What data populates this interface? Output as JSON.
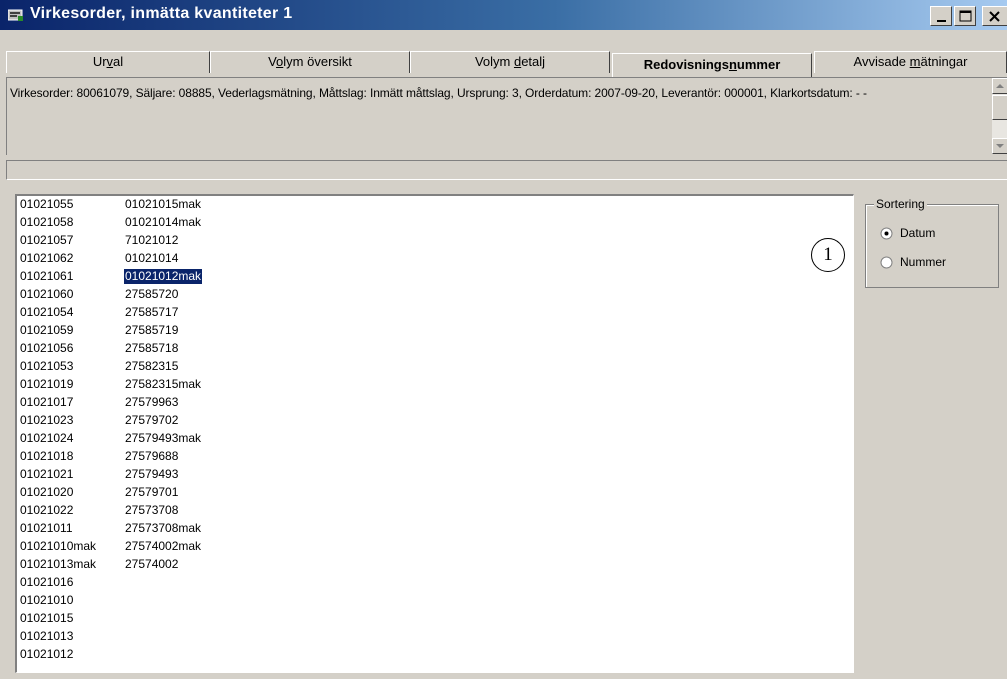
{
  "window": {
    "title": "Virkesorder, inmätta kvantiteter 1"
  },
  "tabs": [
    {
      "pre": "Ur",
      "key": "v",
      "post": "al"
    },
    {
      "pre": "V",
      "key": "o",
      "post": "lym översikt"
    },
    {
      "pre": "Volym ",
      "key": "d",
      "post": "etalj"
    },
    {
      "pre": "Redovisnings",
      "key": "n",
      "post": "ummer"
    },
    {
      "pre": "Avvisade ",
      "key": "m",
      "post": "ätningar"
    }
  ],
  "info": {
    "text": "Virkesorder: 80061079, Säljare: 08885, Vederlagsmätning, Måttslag: Inmätt måttslag, Ursprung: 3, Orderdatum: 2007-09-20, Leverantör: 000001, Klarkortsdatum:   - -"
  },
  "list": {
    "rows": [
      [
        "01021055",
        "01021015mak"
      ],
      [
        "01021058",
        "01021014mak"
      ],
      [
        "01021057",
        "71021012"
      ],
      [
        "01021062",
        "01021014"
      ],
      [
        "01021061",
        "01021012mak"
      ],
      [
        "01021060",
        "27585720"
      ],
      [
        "01021054",
        "27585717"
      ],
      [
        "01021059",
        "27585719"
      ],
      [
        "01021056",
        "27585718"
      ],
      [
        "01021053",
        "27582315"
      ],
      [
        "01021019",
        "27582315mak"
      ],
      [
        "01021017",
        "27579963"
      ],
      [
        "01021023",
        "27579702"
      ],
      [
        "01021024",
        "27579493mak"
      ],
      [
        "01021018",
        "27579688"
      ],
      [
        "01021021",
        "27579493"
      ],
      [
        "01021020",
        "27579701"
      ],
      [
        "01021022",
        "27573708"
      ],
      [
        "01021011",
        "27573708mak"
      ],
      [
        "01021010mak",
        "27574002mak"
      ],
      [
        "01021013mak",
        "27574002"
      ],
      [
        "01021016",
        ""
      ],
      [
        "01021010",
        ""
      ],
      [
        "01021015",
        ""
      ],
      [
        "01021013",
        ""
      ],
      [
        "01021012",
        ""
      ]
    ],
    "selected_row": 4
  },
  "sorting": {
    "legend": "Sortering",
    "options": [
      {
        "label": "Datum",
        "checked": true
      },
      {
        "label": "Nummer",
        "checked": false
      }
    ]
  },
  "callout": {
    "number": "1"
  }
}
